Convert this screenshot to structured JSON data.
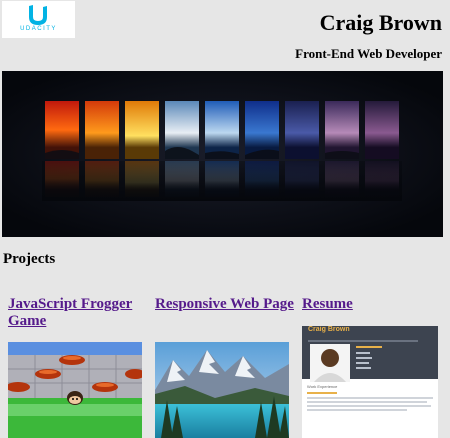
{
  "header": {
    "logo_text": "UDACITY",
    "name": "Craig Brown",
    "role": "Front-End Web Developer"
  },
  "projects": {
    "heading": "Projects",
    "items": [
      {
        "title": "JavaScript Frogger Game"
      },
      {
        "title": "Responsive Web Page"
      },
      {
        "title": "Resume"
      }
    ]
  },
  "resume_thumb": {
    "name": "Craig Brown",
    "section": "Work Experience"
  },
  "colors": {
    "background": "#e6e6e6",
    "link_visited": "#551a8b",
    "logo_blue": "#02b3e4",
    "resume_header": "#3d4450",
    "resume_accent": "#e8b14a"
  }
}
